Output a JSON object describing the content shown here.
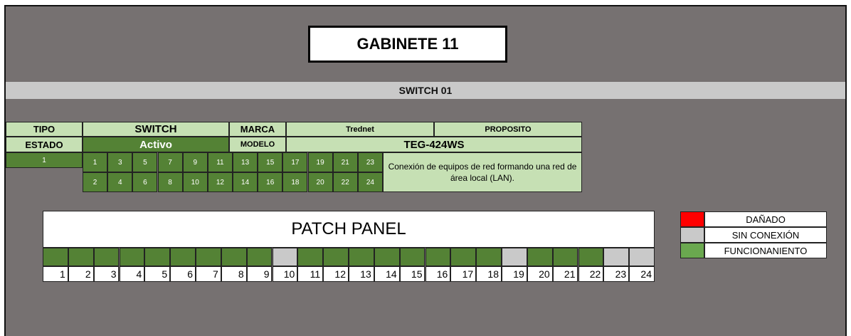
{
  "header": {
    "title": "GABINETE 11"
  },
  "switch_bar": {
    "label": "SWITCH 01"
  },
  "info": {
    "tipo_label": "TIPO",
    "tipo_value": "SWITCH",
    "marca_label": "MARCA",
    "marca_value": "Trednet",
    "proposito_label": "PROPOSITO",
    "estado_label": "ESTADO",
    "estado_value": "Activo",
    "modelo_label": "MODELO",
    "modelo_value": "TEG-424WS",
    "unit_number": "1",
    "purpose_text": "Conexión de equipos de red formando una red de área local (LAN).",
    "ports_top": [
      "1",
      "3",
      "5",
      "7",
      "9",
      "11",
      "13",
      "15",
      "17",
      "19",
      "21",
      "23"
    ],
    "ports_bottom": [
      "2",
      "4",
      "6",
      "8",
      "10",
      "12",
      "14",
      "16",
      "18",
      "20",
      "22",
      "24"
    ]
  },
  "patch_panel": {
    "title": "PATCH PANEL",
    "ports": [
      {
        "number": "1",
        "status": "funcionamiento"
      },
      {
        "number": "2",
        "status": "funcionamiento"
      },
      {
        "number": "3",
        "status": "funcionamiento"
      },
      {
        "number": "4",
        "status": "funcionamiento"
      },
      {
        "number": "5",
        "status": "funcionamiento"
      },
      {
        "number": "6",
        "status": "funcionamiento"
      },
      {
        "number": "7",
        "status": "funcionamiento"
      },
      {
        "number": "8",
        "status": "funcionamiento"
      },
      {
        "number": "9",
        "status": "funcionamiento"
      },
      {
        "number": "10",
        "status": "sin-conexion"
      },
      {
        "number": "11",
        "status": "funcionamiento"
      },
      {
        "number": "12",
        "status": "funcionamiento"
      },
      {
        "number": "13",
        "status": "funcionamiento"
      },
      {
        "number": "14",
        "status": "funcionamiento"
      },
      {
        "number": "15",
        "status": "funcionamiento"
      },
      {
        "number": "16",
        "status": "funcionamiento"
      },
      {
        "number": "17",
        "status": "funcionamiento"
      },
      {
        "number": "18",
        "status": "funcionamiento"
      },
      {
        "number": "19",
        "status": "sin-conexion"
      },
      {
        "number": "20",
        "status": "funcionamiento"
      },
      {
        "number": "21",
        "status": "funcionamiento"
      },
      {
        "number": "22",
        "status": "funcionamiento"
      },
      {
        "number": "23",
        "status": "sin-conexion"
      },
      {
        "number": "24",
        "status": "sin-conexion"
      }
    ]
  },
  "legend": [
    {
      "label": "DAÑADO",
      "color": "#ff0000"
    },
    {
      "label": "SIN CONEXIÓN",
      "color": "#c9c9c9"
    },
    {
      "label": "FUNCIONANIENTO",
      "color": "#6aa84f"
    }
  ],
  "colors": {
    "background": "#767171",
    "light_green": "#c6e0b4",
    "dark_green": "#548235",
    "gray": "#c9c9c9",
    "red": "#ff0000"
  }
}
